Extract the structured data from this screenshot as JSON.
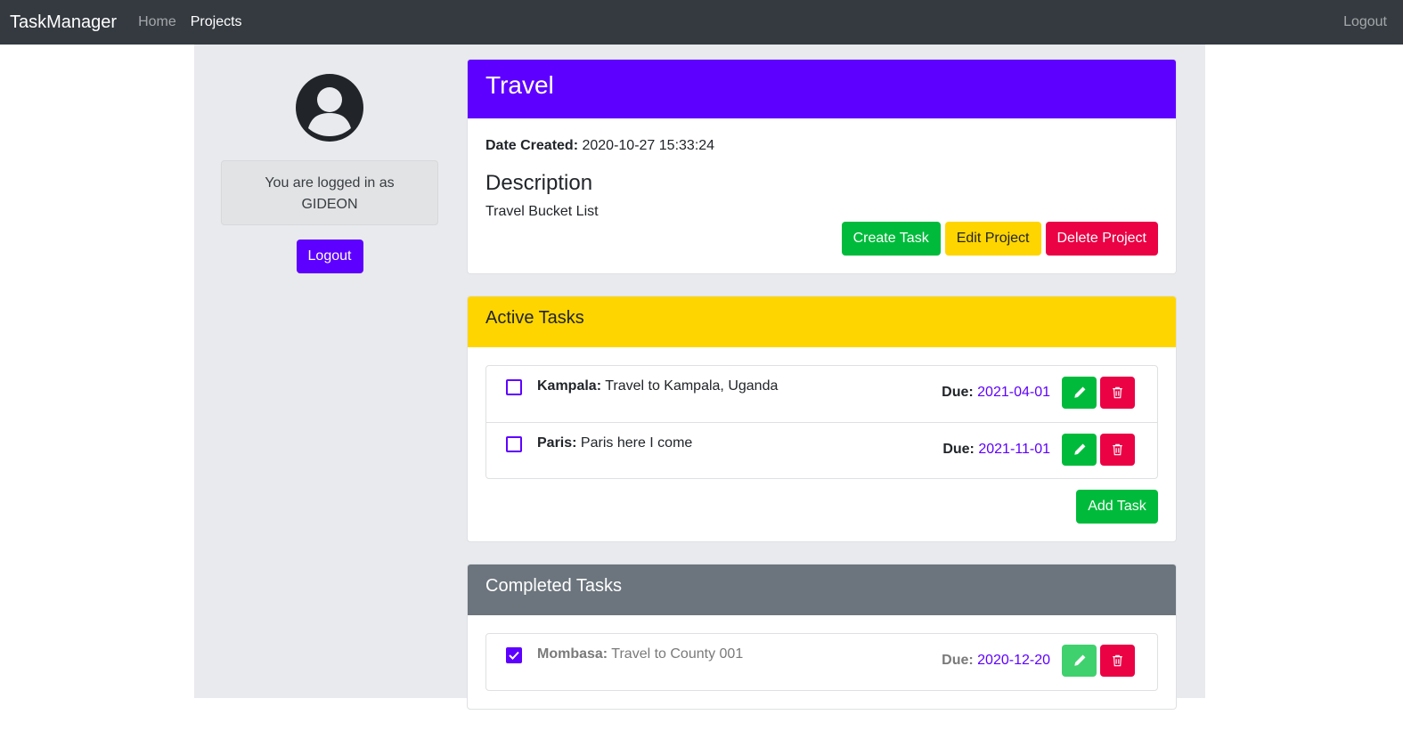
{
  "nav": {
    "brand": "TaskManager",
    "home": "Home",
    "projects": "Projects",
    "logout": "Logout"
  },
  "sidebar": {
    "login_line1": "You are logged in as",
    "username": "GIDEON",
    "logout_button": "Logout"
  },
  "project": {
    "title": "Travel",
    "date_label": "Date Created:",
    "date_value": "2020-10-27 15:33:24",
    "description_heading": "Description",
    "description": "Travel Bucket List",
    "create_task": "Create Task",
    "edit_project": "Edit Project",
    "delete_project": "Delete Project"
  },
  "active_tasks": {
    "heading": "Active Tasks",
    "due_label": "Due:",
    "items": [
      {
        "name": "Kampala:",
        "description": "Travel to Kampala, Uganda",
        "due": "2021-04-01"
      },
      {
        "name": "Paris:",
        "description": "Paris here I come",
        "due": "2021-11-01"
      }
    ],
    "add_task": "Add Task"
  },
  "completed_tasks": {
    "heading": "Completed Tasks",
    "due_label": "Due:",
    "items": [
      {
        "name": "Mombasa:",
        "description": "Travel to County 001",
        "due": "2020-12-20"
      }
    ]
  },
  "colors": {
    "primary": "#5e00ff",
    "success": "#00bb3b",
    "warning": "#ffd500",
    "danger": "#ea0245",
    "secondary": "#6c757d",
    "navbar": "#343a40"
  },
  "icons": {
    "avatar": "user-circle-icon",
    "edit": "pencil-icon",
    "delete": "trash-icon",
    "check": "checkmark-icon"
  }
}
